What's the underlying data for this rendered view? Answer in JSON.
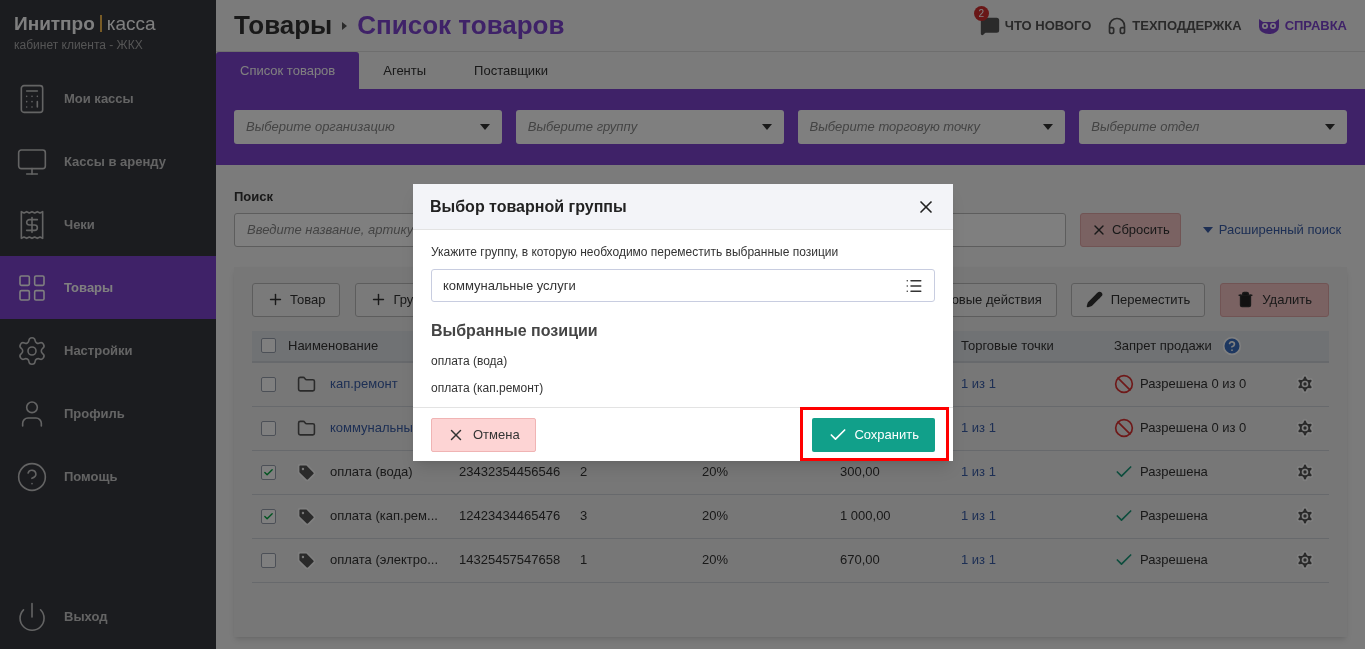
{
  "sidebar": {
    "brand": "Инитпро",
    "brand_suffix": "касса",
    "subtitle": "кабинет клиента - ЖКХ",
    "items": [
      {
        "label": "Мои кассы",
        "selected": false
      },
      {
        "label": "Кассы в аренду",
        "selected": false
      },
      {
        "label": "Чеки",
        "selected": false
      },
      {
        "label": "Товары",
        "selected": true
      },
      {
        "label": "Настройки",
        "selected": false
      },
      {
        "label": "Профиль",
        "selected": false
      },
      {
        "label": "Помощь",
        "selected": false
      }
    ],
    "logout": "Выход"
  },
  "header": {
    "breadcrumb": [
      "Товары",
      "Список товаров"
    ],
    "links": [
      {
        "label": "ЧТО НОВОГО",
        "badge": "2"
      },
      {
        "label": "ТЕХПОДДЕРЖКА"
      },
      {
        "label": "СПРАВКА"
      }
    ]
  },
  "tabs": [
    {
      "label": "Список товаров",
      "selected": true
    },
    {
      "label": "Агенты",
      "selected": false
    },
    {
      "label": "Поставщики",
      "selected": false
    }
  ],
  "filters": [
    {
      "placeholder": "Выберите организацию"
    },
    {
      "placeholder": "Выберите группу"
    },
    {
      "placeholder": "Выберите торговую точку"
    },
    {
      "placeholder": "Выберите отдел"
    }
  ],
  "search": {
    "label": "Поиск",
    "placeholder": "Введите название, артику",
    "reset": "Сбросить",
    "advanced": "Расширенный поиск"
  },
  "toolbar": {
    "left": [
      {
        "label": "Товар"
      },
      {
        "label": "Гру"
      }
    ],
    "group_actions": "овые действия",
    "move": "Переместить",
    "delete": "Удалить"
  },
  "table": {
    "select_all": false,
    "columns": [
      {
        "label": "Наименование"
      },
      {
        "label": "Торговые точки"
      },
      {
        "label": "Запрет продажи"
      }
    ],
    "rows": [
      {
        "checked": false,
        "kind": "folder",
        "name": "кап.ремонт",
        "points": "1 из 1",
        "ban": {
          "kind": "blocked",
          "text": "Разрешена 0 из 0"
        }
      },
      {
        "checked": false,
        "kind": "folder",
        "name": "коммунальны",
        "points": "1 из 1",
        "ban": {
          "kind": "blocked",
          "text": "Разрешена 0 из 0"
        }
      },
      {
        "checked": true,
        "kind": "item",
        "name": "оплата (вода)",
        "article": "23432354456546",
        "qty": "2",
        "vat": "20%",
        "price": "300,00",
        "points": "1 из 1",
        "ban": {
          "kind": "allowed",
          "text": "Разрешена"
        }
      },
      {
        "checked": true,
        "kind": "item",
        "name": "оплата (кап.рем...",
        "article": "12423434465476",
        "qty": "3",
        "vat": "20%",
        "price": "1 000,00",
        "points": "1 из 1",
        "ban": {
          "kind": "allowed",
          "text": "Разрешена"
        }
      },
      {
        "checked": false,
        "kind": "item",
        "name": "оплата (электро...",
        "article": "14325457547658",
        "qty": "1",
        "vat": "20%",
        "price": "670,00",
        "points": "1 из 1",
        "ban": {
          "kind": "allowed",
          "text": "Разрешена"
        }
      }
    ]
  },
  "modal": {
    "title": "Выбор товарной группы",
    "prompt": "Укажите группу, в которую необходимо переместить выбранные позиции",
    "group_value": "коммунальные услуги",
    "selected_title": "Выбранные позиции",
    "selected_items": [
      "оплата (вода)",
      "оплата (кап.ремонт)"
    ],
    "cancel": "Отмена",
    "save": "Сохранить",
    "save_highlighted": true
  }
}
